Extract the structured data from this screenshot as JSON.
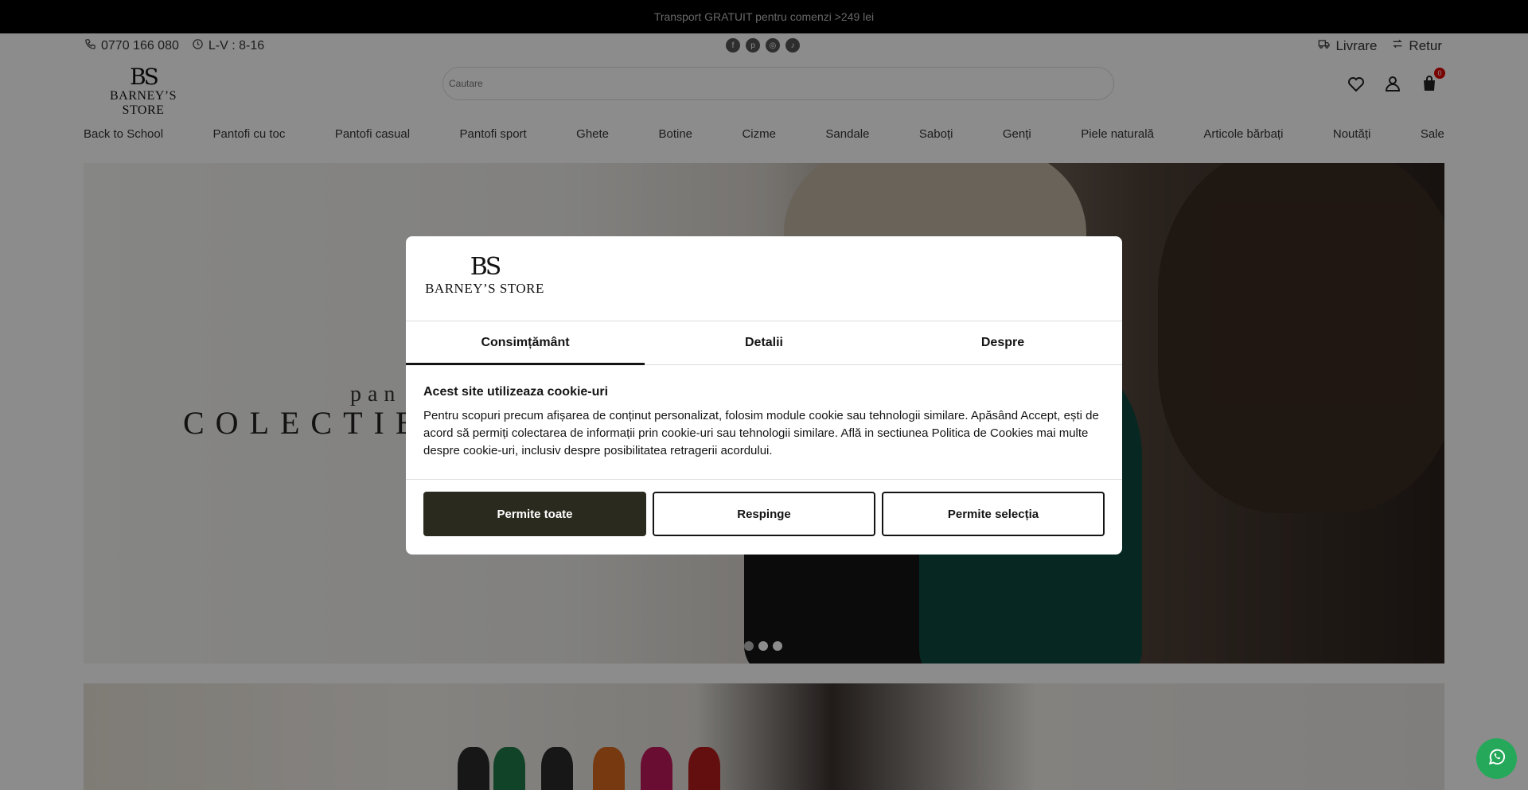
{
  "promo": {
    "text": "Transport GRATUIT pentru comenzi >249 lei"
  },
  "infobar": {
    "phone": "0770 166 080",
    "hours": "L-V : 8-16",
    "socials": [
      "facebook-icon",
      "pinterest-icon",
      "instagram-icon",
      "tiktok-icon"
    ],
    "delivery_label": "Livrare",
    "return_label": "Retur"
  },
  "header": {
    "logo_mono": "BS",
    "logo_text": "BARNEY’S STORE",
    "search_placeholder": "Cautare",
    "cart_count": "0"
  },
  "nav": {
    "items": [
      "Back to School",
      "Pantofi cu toc",
      "Pantofi casual",
      "Pantofi sport",
      "Ghete",
      "Botine",
      "Cizme",
      "Sandale",
      "Saboți",
      "Genți",
      "Piele naturală",
      "Articole bărbați",
      "Noutăți",
      "Sale"
    ]
  },
  "hero": {
    "subtitle": "pan",
    "title": "COLECTIE",
    "slides": 3,
    "active_slide": 2
  },
  "modal": {
    "logo_mono": "BS",
    "logo_text": "BARNEY’S STORE",
    "tabs": [
      "Consimțământ",
      "Detalii",
      "Despre"
    ],
    "active_tab": "Consimțământ",
    "title": "Acest site utilizeaza cookie-uri",
    "body": "Pentru scopuri precum afișarea de conținut personalizat, folosim module cookie sau tehnologii similare. Apăsând Accept, ești de acord să permiți colectarea de informații prin cookie-uri sau tehnologii similare. Află in sectiunea Politica de Cookies mai multe despre cookie-uri, inclusiv despre posibilitatea retragerii acordului.",
    "buttons": {
      "allow_all": "Permite toate",
      "reject": "Respinge",
      "allow_selection": "Permite selecția"
    }
  },
  "colors": {
    "primary_button": "#2a2a1e",
    "whatsapp": "#25a85a",
    "badge": "#dd0000"
  }
}
